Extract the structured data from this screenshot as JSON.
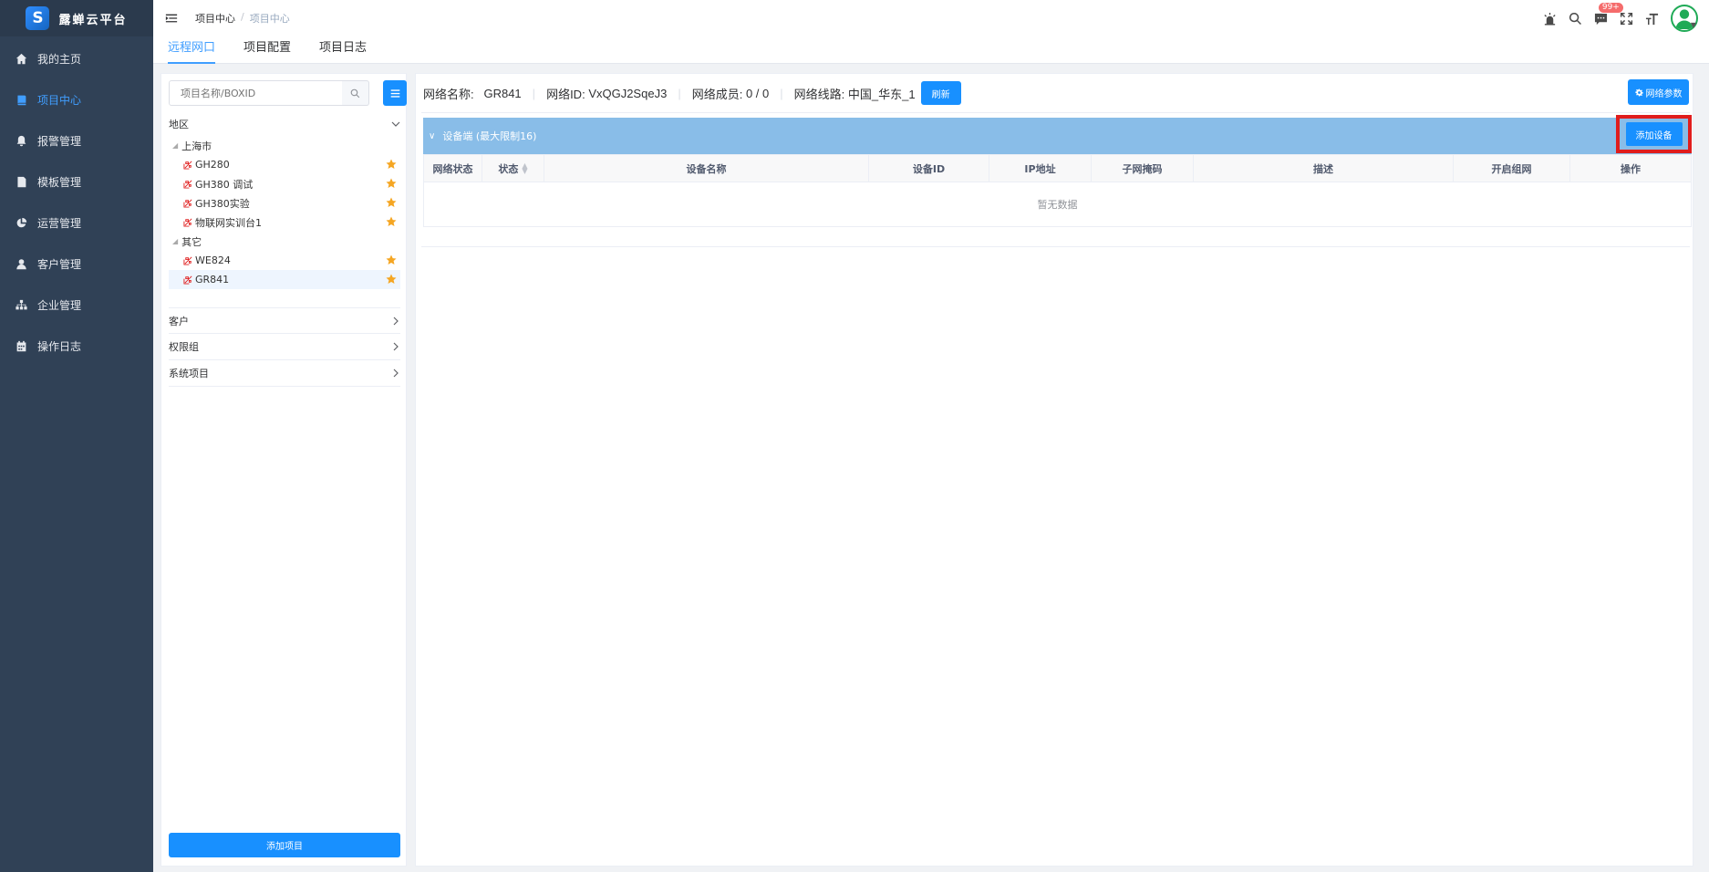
{
  "app": {
    "title": "露蝉云平台",
    "logo_letter": "S"
  },
  "sidebar": {
    "items": [
      {
        "label": "我的主页",
        "icon": "home-icon",
        "active": false
      },
      {
        "label": "项目中心",
        "icon": "project-icon",
        "active": true
      },
      {
        "label": "报警管理",
        "icon": "bell-icon",
        "active": false
      },
      {
        "label": "模板管理",
        "icon": "template-icon",
        "active": false
      },
      {
        "label": "运营管理",
        "icon": "pie-chart-icon",
        "active": false
      },
      {
        "label": "客户管理",
        "icon": "user-icon",
        "active": false
      },
      {
        "label": "企业管理",
        "icon": "org-icon",
        "active": false
      },
      {
        "label": "操作日志",
        "icon": "calendar-icon",
        "active": false
      }
    ]
  },
  "navbar": {
    "breadcrumb": [
      "项目中心",
      "项目中心"
    ],
    "message_badge": "99+"
  },
  "tabs": [
    {
      "label": "远程网口",
      "active": true
    },
    {
      "label": "项目配置",
      "active": false
    },
    {
      "label": "项目日志",
      "active": false
    }
  ],
  "left_panel": {
    "search_placeholder": "项目名称/BOXID",
    "region_label": "地区",
    "groups": [
      {
        "name": "上海市",
        "items": [
          {
            "name": "GH280",
            "selected": false
          },
          {
            "name": "GH380 调试",
            "selected": false
          },
          {
            "name": "GH380实验",
            "selected": false
          },
          {
            "name": "物联网实训台1",
            "selected": false
          }
        ]
      },
      {
        "name": "其它",
        "items": [
          {
            "name": "WE824",
            "selected": false
          },
          {
            "name": "GR841",
            "selected": true
          }
        ]
      }
    ],
    "sections": [
      "客户",
      "权限组",
      "系统项目"
    ],
    "add_project_label": "添加项目"
  },
  "network": {
    "name_label": "网络名称:",
    "name_value": "GR841",
    "id_label": "网络ID:",
    "id_value": "VxQGJ2SqeJ3",
    "members_label": "网络成员:",
    "members_value": "0 / 0",
    "route_label": "网络线路:",
    "route_value": "中国_华东_1",
    "refresh_label": "刷新",
    "params_label": "网络参数"
  },
  "devices": {
    "title": "设备端 (最大限制16)",
    "add_label": "添加设备",
    "columns": [
      "网络状态",
      "状态",
      "设备名称",
      "设备ID",
      "IP地址",
      "子网掩码",
      "描述",
      "开启组网",
      "操作"
    ],
    "empty_text": "暂无数据"
  },
  "colors": {
    "sidebar_bg": "#304156",
    "accent": "#1890ff",
    "active_text": "#409eff",
    "device_header": "#89bde8",
    "highlight_border": "#e01d1d",
    "star": "#f5a623"
  }
}
